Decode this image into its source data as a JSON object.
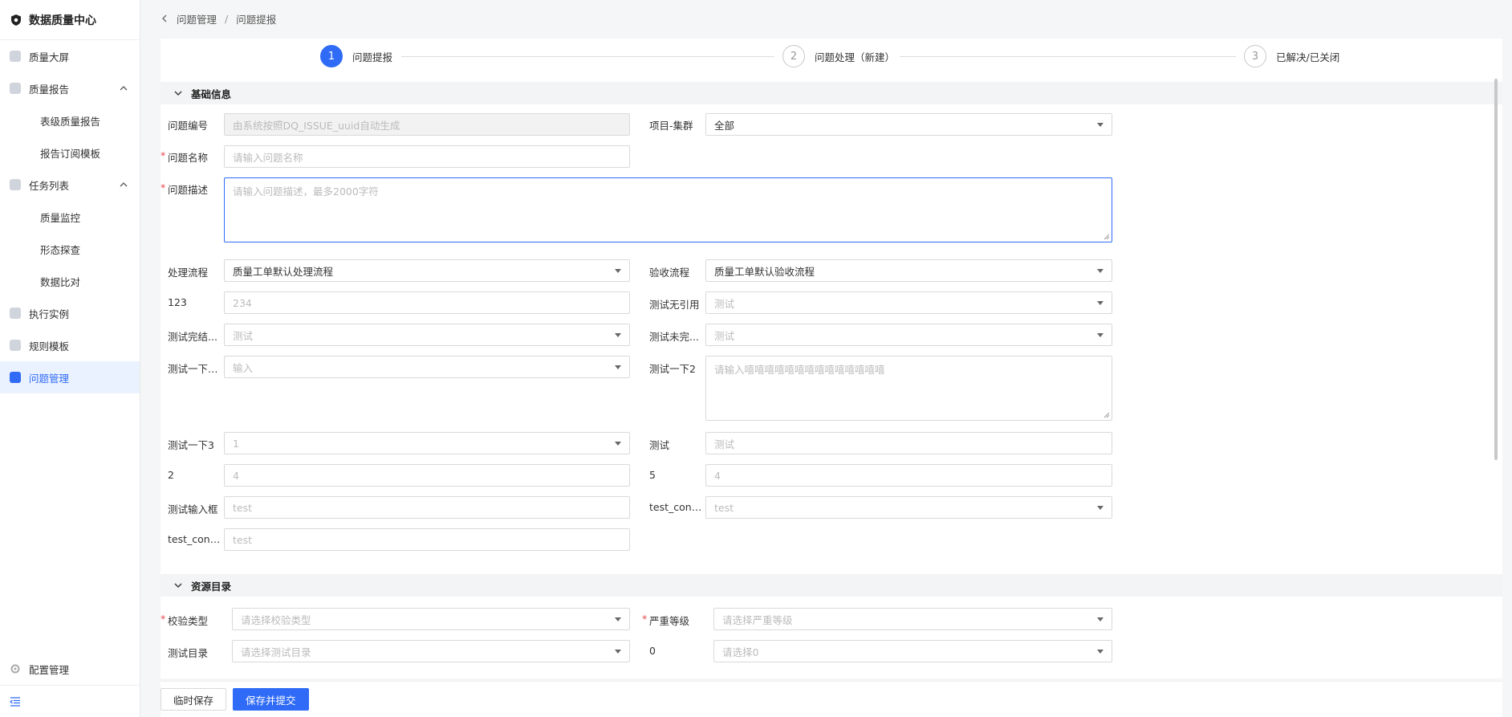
{
  "app": {
    "title": "数据质量中心"
  },
  "sidebar": {
    "items": [
      {
        "label": "质量大屏",
        "icon": "pie-chart-icon"
      },
      {
        "label": "质量报告",
        "icon": "report-icon"
      },
      {
        "label": "表级质量报告",
        "sub": true
      },
      {
        "label": "报告订阅模板",
        "sub": true
      },
      {
        "label": "任务列表",
        "icon": "task-list-icon"
      },
      {
        "label": "质量监控",
        "sub": true
      },
      {
        "label": "形态探查",
        "sub": true
      },
      {
        "label": "数据比对",
        "sub": true
      },
      {
        "label": "执行实例",
        "icon": "instance-icon"
      },
      {
        "label": "规则模板",
        "icon": "template-icon"
      },
      {
        "label": "问题管理",
        "icon": "issue-icon",
        "active": true
      }
    ],
    "config_label": "配置管理"
  },
  "breadcrumb": {
    "parent": "问题管理",
    "sep": "/",
    "current": "问题提报"
  },
  "steps": [
    {
      "num": "1",
      "label": "问题提报",
      "active": true
    },
    {
      "num": "2",
      "label": "问题处理（新建）"
    },
    {
      "num": "3",
      "label": "已解决/已关闭"
    }
  ],
  "sections": {
    "basic": "基础信息",
    "resource": "资源目录"
  },
  "form": {
    "issue_no": {
      "label": "问题编号",
      "placeholder": "由系统按照DQ_ISSUE_uuid自动生成"
    },
    "project_cluster": {
      "label": "项目-集群",
      "value": "全部"
    },
    "issue_name": {
      "label": "问题名称",
      "placeholder": "请输入问题名称"
    },
    "issue_desc": {
      "label": "问题描述",
      "placeholder": "请输入问题描述，最多2000字符"
    },
    "process_flow": {
      "label": "处理流程",
      "value": "质量工单默认处理流程"
    },
    "accept_flow": {
      "label": "验收流程",
      "value": "质量工单默认验收流程"
    },
    "f123": {
      "label": "123",
      "placeholder": "234"
    },
    "test_no_ref": {
      "label": "测试无引用",
      "placeholder": "测试"
    },
    "test_done": {
      "label": "测试完结...",
      "placeholder": "测试"
    },
    "test_undone": {
      "label": "测试未完...",
      "placeholder": "测试"
    },
    "test2a": {
      "label": "测试一下2...",
      "placeholder": "输入"
    },
    "test2b": {
      "label": "测试一下2",
      "placeholder": "请输入嘻嘻嘻嘻嘻嘻嘻嘻嘻嘻嘻嘻嘻嘻"
    },
    "test3": {
      "label": "测试一下3",
      "placeholder": "1"
    },
    "test": {
      "label": "测试",
      "placeholder": "测试"
    },
    "f2": {
      "label": "2",
      "placeholder": "4"
    },
    "f5": {
      "label": "5",
      "placeholder": "4"
    },
    "test_input": {
      "label": "测试输入框",
      "placeholder": "test"
    },
    "test_conf1": {
      "label": "test_confi...",
      "placeholder": "test"
    },
    "test_conf2": {
      "label": "test_confi...",
      "placeholder": "test"
    },
    "check_type": {
      "label": "校验类型",
      "placeholder": "请选择校验类型"
    },
    "severity": {
      "label": "严重等级",
      "placeholder": "请选择严重等级"
    },
    "test_dir": {
      "label": "测试目录",
      "placeholder": "请选择测试目录"
    },
    "zero": {
      "label": "0",
      "placeholder": "请选择0"
    }
  },
  "footer": {
    "temp_save": "临时保存",
    "save_submit": "保存并提交"
  },
  "colors": {
    "primary": "#2f6bf6",
    "required": "#e5484d"
  }
}
